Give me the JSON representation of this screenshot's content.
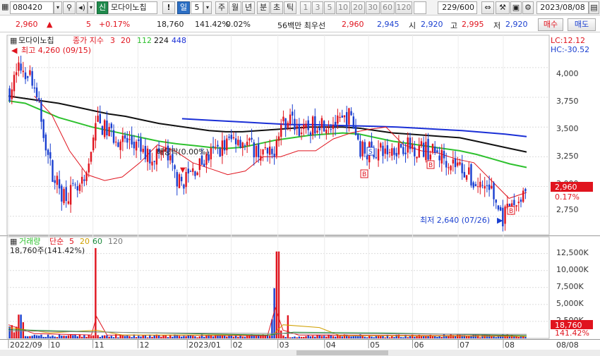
{
  "toolbar": {
    "code": "080420",
    "badge": "신",
    "name": "모다이노칩",
    "info_mark": "!",
    "period_active": "일",
    "period_num": "5",
    "periods": [
      "주",
      "월",
      "년",
      "분",
      "초",
      "틱"
    ],
    "intervals": [
      "1",
      "3",
      "5",
      "10",
      "20",
      "30",
      "60",
      "120"
    ],
    "count": "229/600",
    "date": "2023/08/08"
  },
  "quote": {
    "price": "2,960",
    "arrow": "▲",
    "change": "5",
    "change_pct": "+0.17%",
    "volume": "18,760",
    "volume_ratio": "141.42%",
    "turnover_rate": "0.02%",
    "priority_label": "56백만 최우선",
    "ask": "2,960",
    "bid": "2,945",
    "open_label": "시",
    "open": "2,920",
    "high_label": "고",
    "high": "2,995",
    "low_label": "저",
    "low": "2,920",
    "buy_label": "매수",
    "sell_label": "매도"
  },
  "price_panel": {
    "name": "모다이노칩",
    "legend_prefix": "종가 지수",
    "legend_ma": [
      "3",
      "20",
      "112",
      "224",
      "448"
    ],
    "lc": "LC:12.12",
    "hc": "HC:-30.52",
    "high_note": "최고 4,260 (09/15)",
    "low_note": "최저 2,640 (07/26)",
    "event_note": "배당락(0.00%)",
    "current_price": "2,960",
    "current_pct": "0.17%",
    "yticks": [
      "4,000",
      "3,750",
      "3,500",
      "3,250",
      "3,000",
      "2,750"
    ]
  },
  "volume_panel": {
    "legend": [
      "거래량",
      "단순",
      "5",
      "20",
      "60",
      "120"
    ],
    "current": "18,760주(141.42%)",
    "current_value": "18,760",
    "current_pct": "141.42%",
    "yticks": [
      "12,500K",
      "10,000K",
      "7,500K",
      "5,000K",
      "2,500K"
    ]
  },
  "xaxis": {
    "labels": [
      "2022/09",
      "10",
      "11",
      "12",
      "2023/01",
      "02",
      "03",
      "04",
      "05",
      "06",
      "07",
      "08"
    ],
    "right_date": "08/08"
  },
  "colors": {
    "up": "#e0141e",
    "down": "#1a3fd0",
    "ma20": "#e0141e",
    "ma112": "#2ec12e",
    "ma224": "#111111",
    "ma448": "#1a2fd6"
  },
  "chart_data": {
    "type": "candlestick",
    "price_range": [
      2600,
      4260
    ],
    "volume_range": [
      0,
      13500000
    ],
    "grid": true,
    "ma112": [
      3720,
      3700,
      3640,
      3580,
      3540,
      3500,
      3470,
      3440,
      3410,
      3380,
      3360,
      3345,
      3330,
      3320,
      3330,
      3360,
      3390,
      3410,
      3430,
      3440,
      3450,
      3440,
      3410,
      3380,
      3360,
      3340,
      3320,
      3300,
      3270,
      3230,
      3190,
      3160
    ],
    "ma224": [
      3760,
      3740,
      3720,
      3700,
      3670,
      3640,
      3610,
      3590,
      3560,
      3530,
      3510,
      3490,
      3470,
      3460,
      3460,
      3470,
      3480,
      3490,
      3500,
      3500,
      3500,
      3490,
      3470,
      3450,
      3440,
      3430,
      3420,
      3410,
      3380,
      3350,
      3320,
      3290
    ],
    "ma448": [
      3570,
      3560,
      3550,
      3540,
      3530,
      3520,
      3520,
      3515,
      3510,
      3505,
      3500,
      3490,
      3480,
      3470,
      3455,
      3440,
      3420
    ],
    "ma20": [
      3760,
      3600,
      3300,
      3100,
      3050,
      3080,
      3200,
      3350,
      3300,
      3200,
      3150,
      3100,
      3130,
      3250,
      3250,
      3300,
      3300,
      3400,
      3450,
      3480,
      3500,
      3350,
      3300,
      3280,
      3230,
      3200,
      3050,
      2900,
      2950
    ]
  }
}
